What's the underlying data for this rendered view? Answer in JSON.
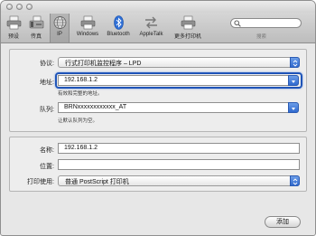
{
  "toolbar": {
    "items": [
      {
        "label": "预设",
        "icon": "default-printer-icon"
      },
      {
        "label": "传真",
        "icon": "fax-icon"
      },
      {
        "label": "IP",
        "icon": "ip-globe-icon"
      },
      {
        "label": "Windows",
        "icon": "windows-printer-icon"
      },
      {
        "label": "Bluetooth",
        "icon": "bluetooth-icon"
      },
      {
        "label": "AppleTalk",
        "icon": "appletalk-icon"
      },
      {
        "label": "更多打印机",
        "icon": "more-printers-icon"
      }
    ],
    "selected": "IP",
    "search_caption": "搜索",
    "search_value": ""
  },
  "form": {
    "protocol_label": "协议:",
    "protocol_value": "行式打印机监控程序 – LPD",
    "address_label": "地址:",
    "address_value": "192.168.1.2",
    "address_hint": "有效和完整的地址。",
    "queue_label": "队列:",
    "queue_value": "BRNxxxxxxxxxxxx_AT",
    "queue_hint": "让默认队列为空。",
    "name_label": "名称:",
    "name_value": "192.168.1.2",
    "location_label": "位置:",
    "location_value": "",
    "print_using_label": "打印使用:",
    "print_using_value": "普通 PostScript 打印机"
  },
  "buttons": {
    "add_label": "添加"
  },
  "colors": {
    "focus": "#1f54b8",
    "popup_arrow": "#3b75d6",
    "window_bg": "#e7e7e7"
  }
}
